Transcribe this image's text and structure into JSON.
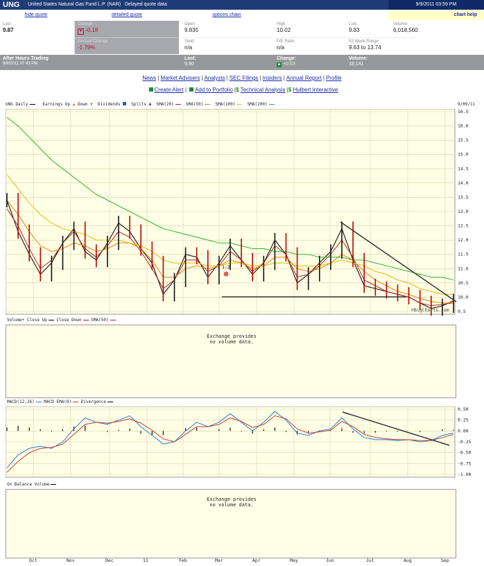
{
  "header": {
    "symbol": "UNG",
    "name": "United States Natural Gas Fund L.P. (NAR)",
    "delay": "Delayed quote data",
    "timestamp": "9/9/2011 03:59 PM"
  },
  "links": {
    "hide_quote": "hide quote",
    "detailed_quote": "detailed quote",
    "options_chain": "options chain",
    "chart_help": "chart help"
  },
  "quote": {
    "last_label": "Last:",
    "last": "9.87",
    "change_label": "Change:",
    "change": "-0.18",
    "pct_label": "Percent Change:",
    "pct": "-1.79%",
    "open_label": "Open:",
    "open": "9.835",
    "yield_label": "Yield:",
    "yield": "n/a",
    "high_label": "High:",
    "high": "10.02",
    "pe_label": "P/E Ratio:",
    "pe": "n/a",
    "low_label": "Low:",
    "low": "9.83",
    "range_label": "52 Week Range:",
    "range": "9.63 to 13.74",
    "volume_label": "Volume:",
    "volume": "6,018,560"
  },
  "after_hours": {
    "title": "After Hours Trading",
    "time": "9/9/2011 07:43 PM",
    "last_label": "Last:",
    "last": "9.90",
    "change_label": "Change:",
    "change": "+0.03",
    "volume_label": "Volume:",
    "volume": "18,141"
  },
  "nav": [
    "News",
    "Market Advisers",
    "Analysts",
    "SEC Filings",
    "Insiders",
    "Annual Report",
    "Profile"
  ],
  "tools": [
    "Create Alert",
    "Add to Portfolio",
    "Technical Analysis",
    "Hulbert Interactive"
  ],
  "price_panel": {
    "legend_title": "UNG Daily",
    "legend_items": [
      "Earnings Up",
      "Down",
      "Dividends",
      "Splits",
      "SMA(20)",
      "SMA(50)",
      "SMA(100)",
      "SMA(200)"
    ],
    "date_label": "9/09/11",
    "split_label": "1:2",
    "yticks": [
      "16.5",
      "16.0",
      "15.5",
      "15.0",
      "14.5",
      "14.0",
      "13.5",
      "13.0",
      "12.5",
      "12.0",
      "11.5",
      "11.0",
      "10.5",
      "10.0",
      "9.5"
    ],
    "credit": "©BigCharts.com"
  },
  "volume_panel": {
    "legend": [
      "Volume+",
      "Close Up",
      "Close Down",
      "SMA(50)"
    ],
    "message": [
      "Exchange provides",
      "no volume data."
    ]
  },
  "macd_panel": {
    "legend": [
      "MACD(12,26)",
      "MACD EMA(9)",
      "Divergence"
    ],
    "yticks": [
      "0.50",
      "0.25",
      "0.00",
      "-0.25",
      "-0.50",
      "-0.75",
      "-1.00"
    ]
  },
  "obv_panel": {
    "legend": "On Balance Volume",
    "message": [
      "Exchange provides",
      "no volume data."
    ]
  },
  "xaxis": [
    "Oct",
    "Nov",
    "Dec",
    "11",
    "Feb",
    "Mar",
    "Apr",
    "May",
    "Jun",
    "Jul",
    "Aug",
    "Sep"
  ],
  "chart_data": {
    "type": "line",
    "series": [
      {
        "name": "UNG Daily",
        "values": [
          13.4,
          12.3,
          11.5,
          10.8,
          11.2,
          11.9,
          12.4,
          11.6,
          11.3,
          11.9,
          12.6,
          12.3,
          11.7,
          11.2,
          10.1,
          10.6,
          11.5,
          11.4,
          10.7,
          11.2,
          11.8,
          11.3,
          10.8,
          11.2,
          12.0,
          11.5,
          10.5,
          10.8,
          11.2,
          11.6,
          12.4,
          11.3,
          10.4,
          10.3,
          10.2,
          10.1,
          10.0,
          9.8,
          9.6,
          9.7,
          9.87
        ]
      },
      {
        "name": "SMA(20)",
        "values": [
          13.1,
          12.5,
          11.7,
          11.0,
          11.3,
          11.9,
          12.3,
          11.7,
          11.4,
          11.8,
          12.3,
          12.1,
          11.6,
          11.0,
          10.3,
          10.6,
          11.3,
          11.3,
          10.9,
          11.1,
          11.6,
          11.3,
          10.9,
          11.2,
          11.8,
          11.5,
          10.7,
          10.8,
          11.1,
          11.5,
          12.0,
          11.4,
          10.6,
          10.4,
          10.2,
          10.1,
          10.0,
          9.8,
          9.7,
          9.75,
          9.8
        ]
      },
      {
        "name": "SMA(50)",
        "values": [
          13.4,
          12.9,
          12.3,
          11.8,
          11.6,
          11.7,
          11.9,
          11.8,
          11.6,
          11.7,
          11.9,
          11.9,
          11.7,
          11.3,
          10.7,
          10.7,
          11.0,
          11.1,
          11.0,
          11.1,
          11.3,
          11.2,
          11.0,
          11.1,
          11.4,
          11.4,
          11.0,
          10.9,
          11.0,
          11.2,
          11.5,
          11.3,
          10.9,
          10.6,
          10.4,
          10.2,
          10.1,
          9.95,
          9.85,
          9.8,
          9.8
        ]
      },
      {
        "name": "SMA(100)",
        "values": [
          14.3,
          13.8,
          13.3,
          12.9,
          12.6,
          12.4,
          12.3,
          12.2,
          12.0,
          12.0,
          12.0,
          11.9,
          11.8,
          11.6,
          11.3,
          11.2,
          11.2,
          11.2,
          11.1,
          11.1,
          11.2,
          11.2,
          11.1,
          11.1,
          11.2,
          11.2,
          11.1,
          11.1,
          11.1,
          11.2,
          11.3,
          11.2,
          11.1,
          10.9,
          10.8,
          10.6,
          10.5,
          10.3,
          10.2,
          10.1,
          10.1
        ]
      },
      {
        "name": "SMA(200)",
        "values": [
          16.3,
          16.0,
          15.6,
          15.2,
          14.8,
          14.5,
          14.2,
          13.9,
          13.6,
          13.4,
          13.2,
          13.0,
          12.8,
          12.6,
          12.4,
          12.3,
          12.2,
          12.1,
          12.0,
          11.9,
          11.9,
          11.8,
          11.7,
          11.7,
          11.6,
          11.6,
          11.5,
          11.5,
          11.4,
          11.4,
          11.4,
          11.3,
          11.3,
          11.2,
          11.1,
          11.0,
          10.9,
          10.8,
          10.7,
          10.7,
          10.6
        ]
      }
    ],
    "ylim": [
      9.5,
      16.5
    ],
    "xlabel": "",
    "ylabel": "",
    "grid": true,
    "macd": {
      "type": "line",
      "ylim": [
        -1.0,
        0.5
      ],
      "series": [
        {
          "name": "MACD(12,26)",
          "values": [
            -0.85,
            -0.55,
            -0.4,
            -0.35,
            -0.4,
            -0.25,
            0.05,
            0.3,
            0.2,
            0.15,
            0.25,
            0.35,
            0.1,
            -0.1,
            -0.3,
            -0.25,
            0.0,
            0.2,
            0.1,
            0.2,
            0.4,
            0.2,
            0.0,
            0.2,
            0.45,
            0.25,
            -0.05,
            -0.1,
            0.0,
            0.05,
            0.3,
            0.05,
            -0.15,
            -0.2,
            -0.2,
            -0.22,
            -0.2,
            -0.25,
            -0.22,
            -0.1,
            -0.05
          ]
        },
        {
          "name": "MACD EMA(9)",
          "values": [
            -0.95,
            -0.7,
            -0.5,
            -0.4,
            -0.38,
            -0.3,
            -0.08,
            0.15,
            0.2,
            0.18,
            0.22,
            0.28,
            0.18,
            0.02,
            -0.18,
            -0.25,
            -0.08,
            0.1,
            0.1,
            0.15,
            0.3,
            0.22,
            0.08,
            0.15,
            0.35,
            0.28,
            0.05,
            -0.05,
            -0.02,
            0.02,
            0.22,
            0.1,
            -0.08,
            -0.15,
            -0.18,
            -0.2,
            -0.2,
            -0.22,
            -0.22,
            -0.15,
            -0.08
          ]
        }
      ]
    }
  }
}
